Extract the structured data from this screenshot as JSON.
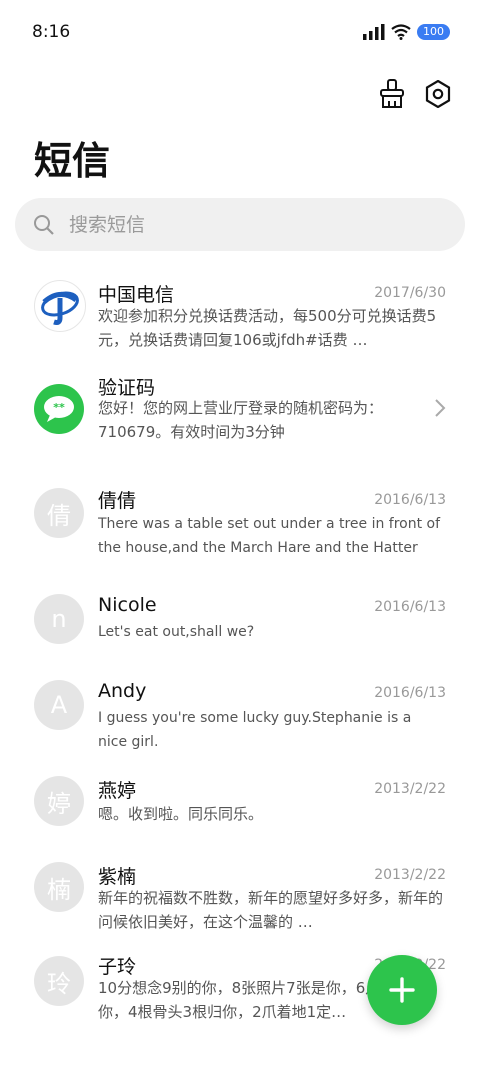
{
  "status": {
    "time": "8:16",
    "battery": "100"
  },
  "header": {
    "title": "短信"
  },
  "search": {
    "placeholder": "搜索短信"
  },
  "conversations": [
    {
      "name": "中国电信",
      "date": "2017/6/30",
      "avatar": "",
      "snippet": "欢迎参加积分兑换话费活动，每500分可兑换话费5元，兑换话费请回复106或jfdh#话费 …"
    },
    {
      "name": "验证码",
      "date": "",
      "avatar": "**",
      "snippet": "您好！您的网上营业厅登录的随机密码为：710679。有效时间为3分钟"
    },
    {
      "name": "倩倩",
      "date": "2016/6/13",
      "avatar": "倩",
      "snippet": "There was a table set out under a tree in front of the house,and the March Hare and the Hatter wer …"
    },
    {
      "name": "Nicole",
      "date": "2016/6/13",
      "avatar": "n",
      "snippet": "Let's eat out,shall we?"
    },
    {
      "name": "Andy",
      "date": "2016/6/13",
      "avatar": "A",
      "snippet": "I guess you're some lucky guy.Stephanie is a nice girl."
    },
    {
      "name": "燕婷",
      "date": "2013/2/22",
      "avatar": "婷",
      "snippet": "嗯。收到啦。同乐同乐。"
    },
    {
      "name": "紫楠",
      "date": "2013/2/22",
      "avatar": "楠",
      "snippet": "新年的祝福数不胜数，新年的愿望好多好多，新年的问候依旧美好，在这个温馨的 …"
    },
    {
      "name": "子玲",
      "date": "2013/2/22",
      "avatar": "玲",
      "snippet": "10分想念9别的你，8张照片7张是你，6月的6只像你，4根骨头3根归你，2爪着地1定…"
    }
  ],
  "colors": {
    "accent": "#2dc44c",
    "telecom_blue": "#1d5fbf"
  }
}
